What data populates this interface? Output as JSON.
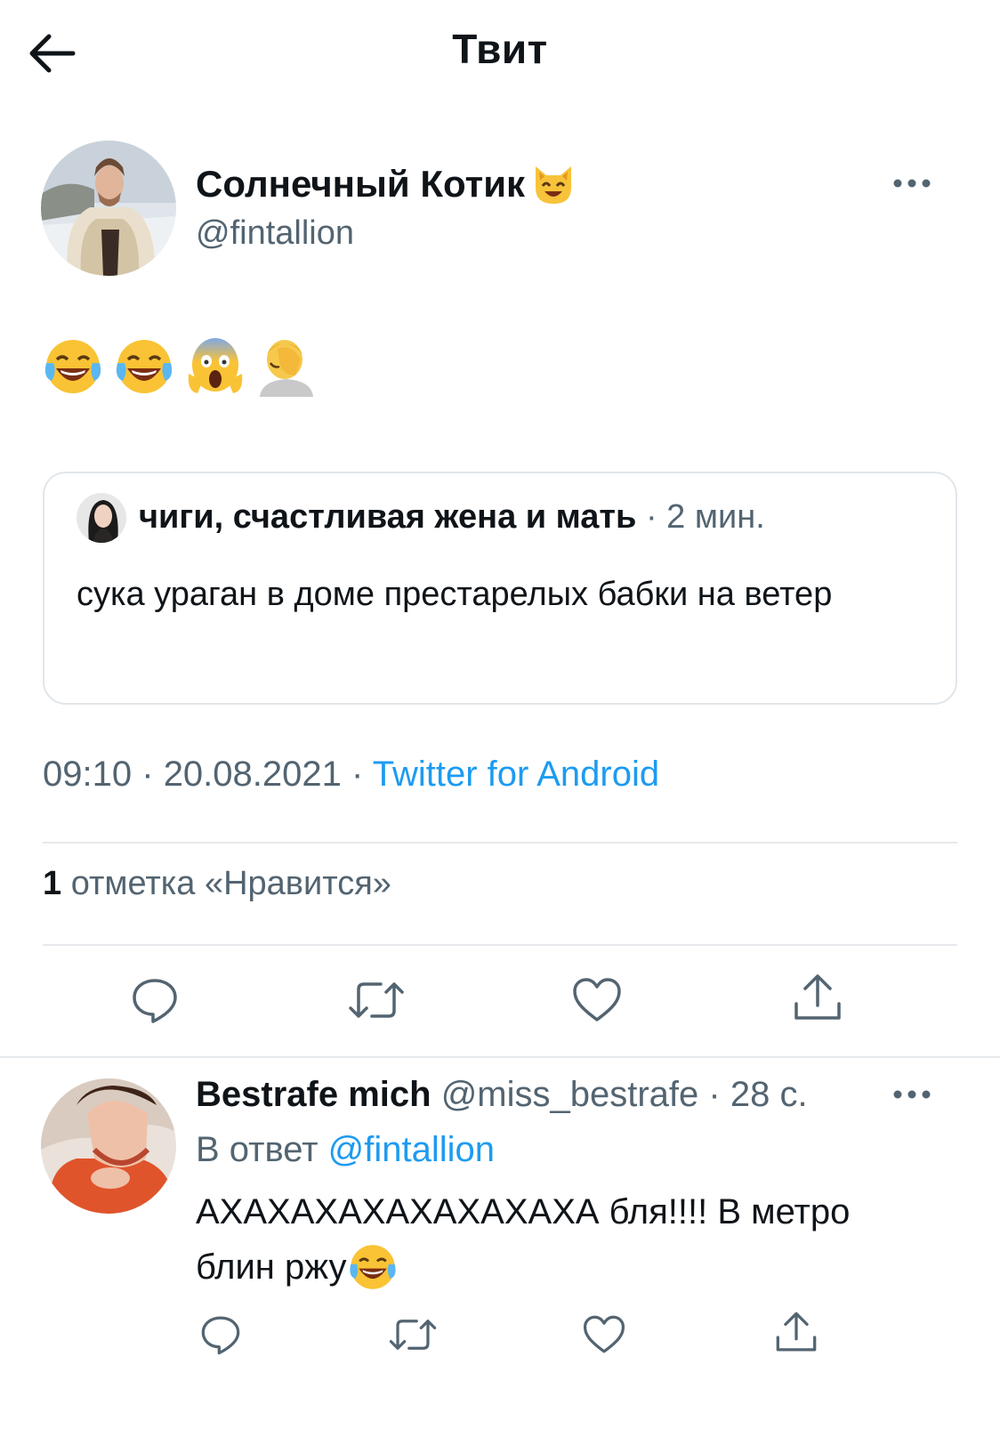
{
  "header": {
    "title": "Твит",
    "back_icon": "arrow-left-icon"
  },
  "main_tweet": {
    "author_name": "Солнечный Котик",
    "author_emoji": "cat-face-emoji",
    "author_handle": "@fintallion",
    "more_icon": "more-horizontal-icon",
    "body_emojis": [
      "face-with-tears-of-joy-emoji",
      "face-with-tears-of-joy-emoji",
      "face-screaming-in-fear-emoji",
      "person-facepalming-emoji"
    ],
    "quote": {
      "author_name": "чиги, счастливая жена и мать",
      "separator": "·",
      "time": "2 мин.",
      "text": "сука ураган в доме престарелых бабки на ветер"
    },
    "time": "09:10",
    "sep": "·",
    "date": "20.08.2021",
    "source": "Twitter for Android",
    "likes_count": "1",
    "likes_label": "отметка «Нравится»",
    "actions": [
      "reply-icon",
      "retweet-icon",
      "like-icon",
      "share-icon"
    ]
  },
  "reply": {
    "author_name": "Bestrafe mich",
    "author_handle": "@miss_bestrafe",
    "separator": "·",
    "time": "28 с.",
    "reply_prefix": "В ответ",
    "reply_to": "@fintallion",
    "text_line1": "АХАХАХАХАХАХАХАХА бля!!!! В метро",
    "text_line2": "блин ржу",
    "text_emoji": "face-with-tears-of-joy-emoji"
  },
  "colors": {
    "link": "#1d9bf0",
    "muted": "#536471",
    "text": "#0f1419",
    "border": "#e1e6ea"
  }
}
